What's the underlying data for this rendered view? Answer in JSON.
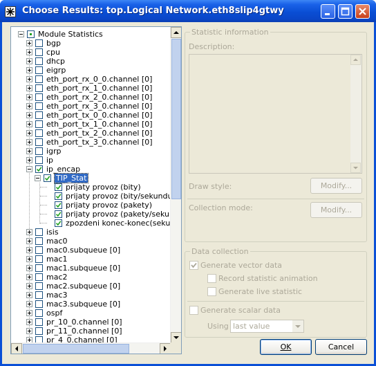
{
  "window": {
    "title": "Choose Results: top.Logical Network.eth8slip4gtwy"
  },
  "tree": {
    "root": "Module Statistics",
    "modules": [
      "bgp",
      "cpu",
      "dhcp",
      "eigrp",
      "eth_port_rx_0_0.channel [0]",
      "eth_port_rx_1_0.channel [0]",
      "eth_port_rx_2_0.channel [0]",
      "eth_port_rx_3_0.channel [0]",
      "eth_port_tx_0_0.channel [0]",
      "eth_port_tx_1_0.channel [0]",
      "eth_port_tx_2_0.channel [0]",
      "eth_port_tx_3_0.channel [0]",
      "igrp",
      "ip",
      "ip_encap"
    ],
    "selected_group": "TIP_Stat",
    "stats": [
      "prijaty provoz (bity)",
      "prijaty provoz (bity/sekundu)",
      "prijaty provoz (pakety)",
      "prijaty provoz (pakety/sekund",
      "zpozdeni konec-konec(sekun"
    ],
    "modules_after": [
      "isis",
      "mac0",
      "mac0.subqueue [0]",
      "mac1",
      "mac1.subqueue [0]",
      "mac2",
      "mac2.subqueue [0]",
      "mac3",
      "mac3.subqueue [0]",
      "ospf",
      "pr_10_0.channel [0]",
      "pr_11_0.channel [0]",
      "pr_4_0.channel [0]"
    ]
  },
  "info": {
    "group_title": "Statistic information",
    "description_label": "Description:",
    "draw_style_label": "Draw style:",
    "modify_label": "Modify...",
    "collection_mode_label": "Collection mode:",
    "modify2_label": "Modify..."
  },
  "collection": {
    "group_title": "Data collection",
    "generate_vector": "Generate vector data",
    "record_animation": "Record statistic animation",
    "generate_live": "Generate live statistic",
    "generate_scalar": "Generate scalar data",
    "using_label": "Using",
    "using_value": "last value"
  },
  "buttons": {
    "ok": "OK",
    "cancel": "Cancel"
  }
}
